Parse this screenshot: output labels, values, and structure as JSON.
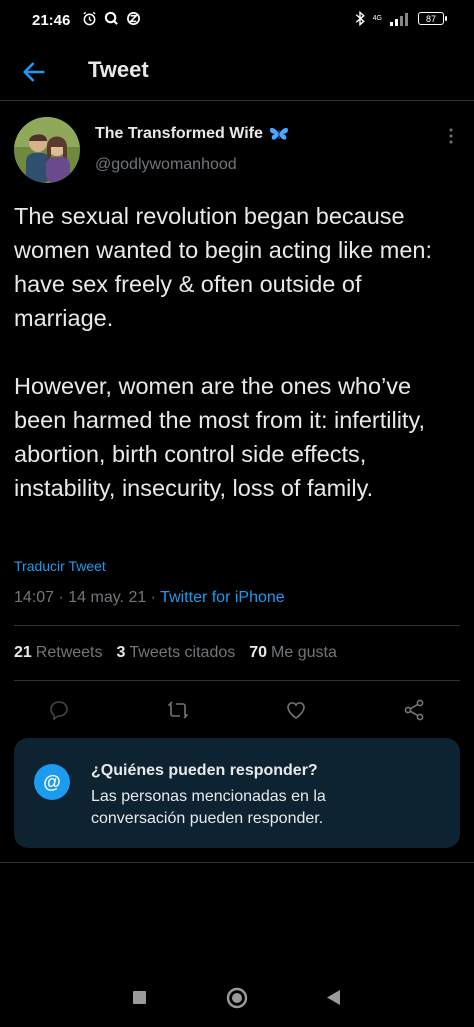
{
  "status_bar": {
    "time": "21:46",
    "network": "4G",
    "battery": "87"
  },
  "header": {
    "title": "Tweet"
  },
  "author": {
    "name": "The Transformed Wife",
    "handle": "@godlywomanhood"
  },
  "tweet": {
    "text": "The sexual revolution began because women wanted to begin acting like men: have sex freely & often outside of marriage.\n\nHowever, women are the ones who’ve been harmed the most from it: infertility, abortion, birth control side effects, instability, insecurity, loss of family.",
    "translate_label": "Traducir Tweet",
    "time": "14:07",
    "date": "14 may. 21",
    "separator": " · ",
    "source": "Twitter for iPhone"
  },
  "stats": {
    "retweets_count": "21",
    "retweets_label": "Retweets",
    "quotes_count": "3",
    "quotes_label": "Tweets citados",
    "likes_count": "70",
    "likes_label": "Me gusta"
  },
  "reply_card": {
    "icon_text": "@",
    "title": "¿Quiénes pueden responder?",
    "body": "Las personas mencionadas en la conversación pueden responder."
  },
  "colors": {
    "accent": "#1d9bf0",
    "background": "#000000",
    "card": "#0e2332",
    "muted": "#71767b"
  }
}
